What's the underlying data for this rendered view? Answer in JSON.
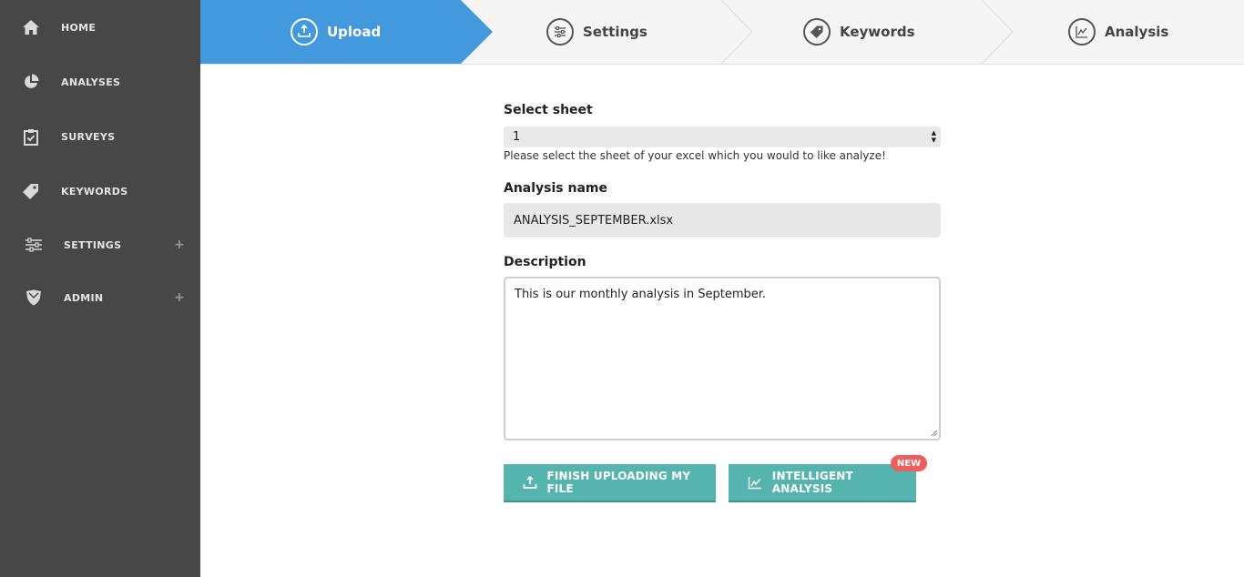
{
  "sidebar": {
    "items": [
      {
        "label": "HOME",
        "icon": "home-icon"
      },
      {
        "label": "ANALYSES",
        "icon": "pie-chart-icon"
      },
      {
        "label": "SURVEYS",
        "icon": "clipboard-check-icon"
      },
      {
        "label": "KEYWORDS",
        "icon": "tag-icon"
      },
      {
        "label": "SETTINGS",
        "icon": "sliders-icon",
        "expand": "+"
      },
      {
        "label": "ADMIN",
        "icon": "shield-icon",
        "expand": "+"
      }
    ]
  },
  "stepper": {
    "steps": [
      {
        "label": "Upload",
        "icon": "upload-icon",
        "active": true
      },
      {
        "label": "Settings",
        "icon": "sliders-icon",
        "active": false
      },
      {
        "label": "Keywords",
        "icon": "tag-icon",
        "active": false
      },
      {
        "label": "Analysis",
        "icon": "line-chart-icon",
        "active": false
      }
    ]
  },
  "form": {
    "sheet_label": "Select sheet",
    "sheet_value": "1",
    "sheet_hint": "Please select the sheet of your excel which you would to like analyze!",
    "name_label": "Analysis name",
    "name_value": "ANALYSIS_SEPTEMBER.xlsx",
    "description_label": "Description",
    "description_value": "This is our monthly analysis in September."
  },
  "actions": {
    "finish_label": "FINISH UPLOADING MY FILE",
    "intelligent_label": "INTELLIGENT ANALYSIS",
    "new_badge": "NEW"
  },
  "colors": {
    "sidebar_bg": "#474747",
    "active_step": "#4399dd",
    "button": "#55b5ae",
    "badge": "#ef5e5e"
  }
}
